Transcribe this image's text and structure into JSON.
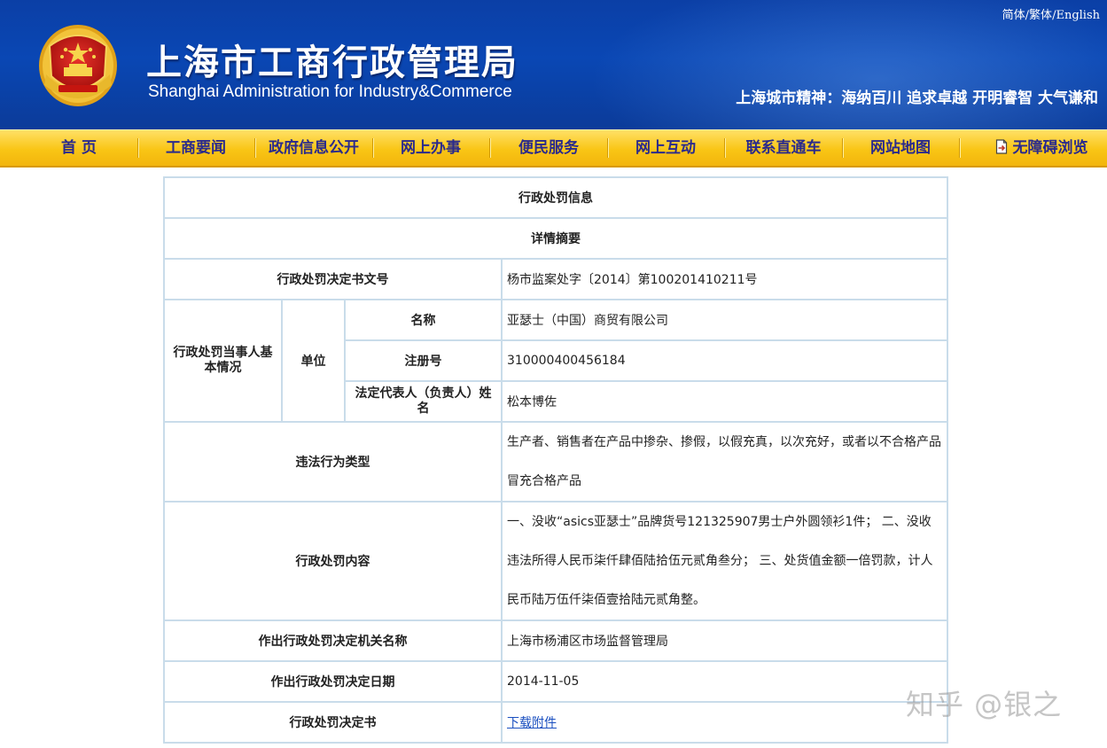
{
  "header": {
    "title": "上海市工商行政管理局",
    "subtitle": "Shanghai Administration for Industry&Commerce",
    "lang_links": [
      "简体",
      "繁体",
      "English"
    ],
    "lang_sep": "/",
    "slogan": "上海城市精神：海纳百川 追求卓越 开明睿智 大气谦和",
    "emblem_icon": "national-emblem-icon"
  },
  "nav": {
    "items": [
      "首 页",
      "工商要闻",
      "政府信息公开",
      "网上办事",
      "便民服务",
      "网上互动",
      "联系直通车",
      "网站地图",
      "无障碍浏览"
    ],
    "accessibility_icon": "document-arrow-icon"
  },
  "record": {
    "section_title": "行政处罚信息",
    "summary_title": "详情摘要",
    "doc_no_label": "行政处罚决定书文号",
    "doc_no": "杨市监案处字〔2014〕第100201410211号",
    "party_label": "行政处罚当事人基本情况",
    "unit_label": "单位",
    "name_label": "名称",
    "name": "亚瑟士（中国）商贸有限公司",
    "reg_no_label": "注册号",
    "reg_no": "310000400456184",
    "rep_label": "法定代表人（负责人）姓名",
    "rep": "松本博佐",
    "violation_type_label": "违法行为类型",
    "violation_type": "生产者、销售者在产品中掺杂、掺假，以假充真，以次充好，或者以不合格产品冒充合格产品",
    "penalty_label": "行政处罚内容",
    "penalty": "一、没收“asics亚瑟士”品牌货号121325907男士户外圆领衫1件； 二、没收违法所得人民币柒仟肆佰陆拾伍元贰角叁分； 三、处货值金额一倍罚款，计人民币陆万伍仟柒佰壹拾陆元贰角整。",
    "authority_label": "作出行政处罚决定机关名称",
    "authority": "上海市杨浦区市场监督管理局",
    "date_label": "作出行政处罚决定日期",
    "date": "2014-11-05",
    "decision_label": "行政处罚决定书",
    "download": "下载附件"
  },
  "watermark": "知乎 @银之",
  "colors": {
    "header_blue": "#0a47b4",
    "nav_yellow": "#f9c515",
    "nav_text": "#2a2a8c",
    "table_border": "#c9dcea",
    "link": "#1a4fc0"
  }
}
